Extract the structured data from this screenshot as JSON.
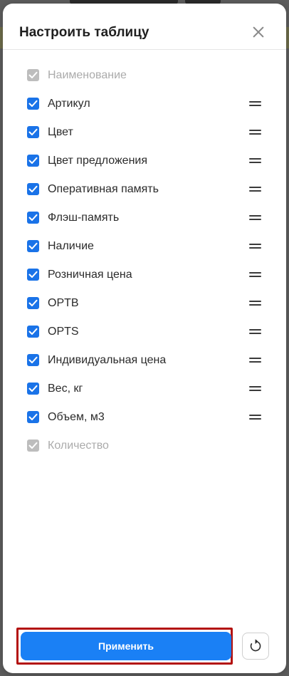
{
  "modal": {
    "title": "Настроить таблицу",
    "close_icon": "close-icon"
  },
  "columns": [
    {
      "label": "Наименование",
      "checked": true,
      "locked": true,
      "draggable": false
    },
    {
      "label": "Артикул",
      "checked": true,
      "locked": false,
      "draggable": true
    },
    {
      "label": "Цвет",
      "checked": true,
      "locked": false,
      "draggable": true
    },
    {
      "label": "Цвет предложения",
      "checked": true,
      "locked": false,
      "draggable": true
    },
    {
      "label": "Оперативная память",
      "checked": true,
      "locked": false,
      "draggable": true
    },
    {
      "label": "Флэш-память",
      "checked": true,
      "locked": false,
      "draggable": true
    },
    {
      "label": "Наличие",
      "checked": true,
      "locked": false,
      "draggable": true
    },
    {
      "label": "Розничная цена",
      "checked": true,
      "locked": false,
      "draggable": true
    },
    {
      "label": "OPTB",
      "checked": true,
      "locked": false,
      "draggable": true
    },
    {
      "label": "OPTS",
      "checked": true,
      "locked": false,
      "draggable": true
    },
    {
      "label": "Индивидуальная цена",
      "checked": true,
      "locked": false,
      "draggable": true
    },
    {
      "label": "Вес, кг",
      "checked": true,
      "locked": false,
      "draggable": true
    },
    {
      "label": "Объем, м3",
      "checked": true,
      "locked": false,
      "draggable": true
    },
    {
      "label": "Количество",
      "checked": true,
      "locked": true,
      "draggable": false
    }
  ],
  "footer": {
    "apply_label": "Применить",
    "reset_icon": "reset-icon"
  },
  "colors": {
    "accent": "#1a80f5",
    "checkbox": "#1a73e8",
    "checkbox_disabled": "#bdbdbd",
    "highlight_frame": "#b3110f"
  }
}
